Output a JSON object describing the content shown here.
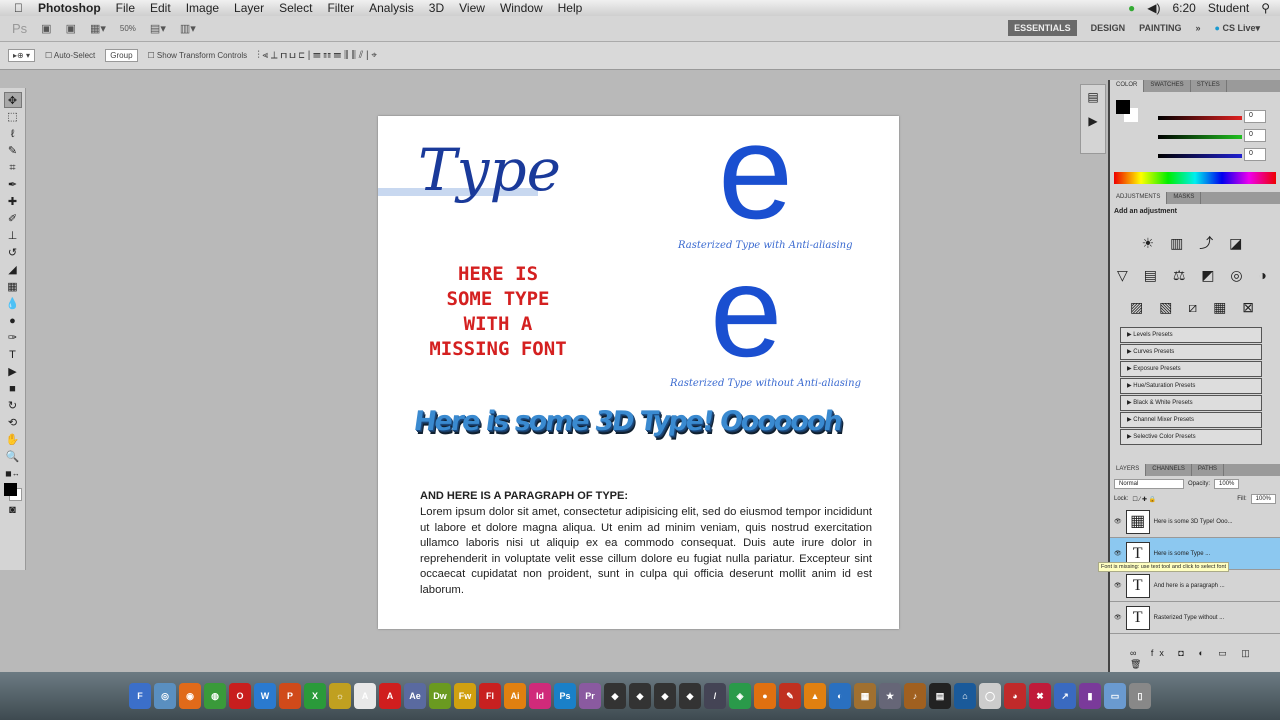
{
  "menubar": {
    "apple": "",
    "app": "Photoshop",
    "items": [
      "File",
      "Edit",
      "Image",
      "Layer",
      "Select",
      "Filter",
      "Analysis",
      "3D",
      "View",
      "Window",
      "Help"
    ],
    "time": "6:20",
    "user": "Student"
  },
  "appbar": {
    "logo": "Ps",
    "zoom": "50%",
    "workspaces": [
      "ESSENTIALS",
      "DESIGN",
      "PAINTING"
    ],
    "more": "»",
    "cslive": "CS Live"
  },
  "options": {
    "auto_select": "Auto-Select",
    "auto_select_value": "Group",
    "show_transform": "Show Transform Controls"
  },
  "panels": {
    "color_tabs": [
      "COLOR",
      "SWATCHES",
      "STYLES"
    ],
    "color_values": {
      "R": "0",
      "G": "0",
      "B": "0"
    },
    "adjust_tabs": [
      "ADJUSTMENTS",
      "MASKS"
    ],
    "adjust_title": "Add an adjustment",
    "presets": [
      "Levels Presets",
      "Curves Presets",
      "Exposure Presets",
      "Hue/Saturation Presets",
      "Black & White Presets",
      "Channel Mixer Presets",
      "Selective Color Presets"
    ],
    "layer_tabs": [
      "LAYERS",
      "CHANNELS",
      "PATHS"
    ],
    "blend_mode": "Normal",
    "opacity_label": "Opacity:",
    "opacity": "100%",
    "lock_label": "Lock:",
    "fill_label": "Fill:",
    "fill": "100%",
    "layers": [
      "Here is some 3D Type! Ooo...",
      "Here is some Type ...",
      "And here is a paragraph ...",
      "Rasterized Type without ..."
    ],
    "tooltip": "Font is missing: use text tool and click to select font"
  },
  "document": {
    "title_word": "Type",
    "e_letter": "e",
    "caption_aa": "Rasterized Type with Anti-aliasing",
    "caption_noaa": "Rasterized Type without Anti-aliasing",
    "missing_font_lines": [
      "HERE IS",
      "SOME TYPE",
      "WITH  A",
      "MISSING FONT"
    ],
    "type3d": "Here is some 3D Type! Ooooooh",
    "para_heading": "AND HERE IS A PARAGRAPH OF TYPE:",
    "para_body": "Lorem ipsum dolor sit amet, consectetur adipisicing elit, sed do eiusmod tempor incididunt ut labore et dolore magna aliqua. Ut enim ad minim veniam, quis nostrud exercitation ullamco laboris nisi ut aliquip ex ea commodo consequat. Duis aute irure dolor in reprehenderit in voluptate velit esse cillum dolore eu fugiat nulla pariatur. Excepteur sint occaecat cupidatat non proident, sunt in culpa qui officia deserunt mollit anim id est laborum."
  },
  "dock": [
    {
      "l": "F",
      "c": "#3b6fc9"
    },
    {
      "l": "◎",
      "c": "#5a8fc0"
    },
    {
      "l": "◉",
      "c": "#e06a1a"
    },
    {
      "l": "◍",
      "c": "#3a9a3a"
    },
    {
      "l": "O",
      "c": "#c81e1e"
    },
    {
      "l": "W",
      "c": "#2a7ad0"
    },
    {
      "l": "P",
      "c": "#d04a1a"
    },
    {
      "l": "X",
      "c": "#2a9a3a"
    },
    {
      "l": "☼",
      "c": "#c0a020"
    },
    {
      "l": "A",
      "c": "#e8e8e8"
    },
    {
      "l": "A",
      "c": "#d01e1e"
    },
    {
      "l": "Ae",
      "c": "#5a6aa0"
    },
    {
      "l": "Dw",
      "c": "#6a9a20"
    },
    {
      "l": "Fw",
      "c": "#d0a010"
    },
    {
      "l": "Fl",
      "c": "#c82020"
    },
    {
      "l": "Ai",
      "c": "#e08010"
    },
    {
      "l": "Id",
      "c": "#d02a7a"
    },
    {
      "l": "Ps",
      "c": "#1a80c8"
    },
    {
      "l": "Pr",
      "c": "#8a5aa0"
    },
    {
      "l": "◆",
      "c": "#333"
    },
    {
      "l": "◆",
      "c": "#333"
    },
    {
      "l": "◆",
      "c": "#333"
    },
    {
      "l": "◆",
      "c": "#333"
    },
    {
      "l": "/",
      "c": "#445"
    },
    {
      "l": "◈",
      "c": "#2a9a4a"
    },
    {
      "l": "●",
      "c": "#e07010"
    },
    {
      "l": "✎",
      "c": "#c03020"
    },
    {
      "l": "▲",
      "c": "#e08010"
    },
    {
      "l": "◐",
      "c": "#2a70c0"
    },
    {
      "l": "▦",
      "c": "#a07030"
    },
    {
      "l": "★",
      "c": "#667"
    },
    {
      "l": "♪",
      "c": "#a06020"
    },
    {
      "l": "▤",
      "c": "#222"
    },
    {
      "l": "⌂",
      "c": "#1a5a9a"
    },
    {
      "l": "◯",
      "c": "#ccc"
    },
    {
      "l": "◕",
      "c": "#c02a2a"
    },
    {
      "l": "✖",
      "c": "#c01a3a"
    },
    {
      "l": "↗",
      "c": "#3a6ac0"
    },
    {
      "l": "▮",
      "c": "#7a3a9a"
    },
    {
      "l": "▭",
      "c": "#6a9ad0"
    },
    {
      "l": "▯",
      "c": "#888"
    }
  ]
}
